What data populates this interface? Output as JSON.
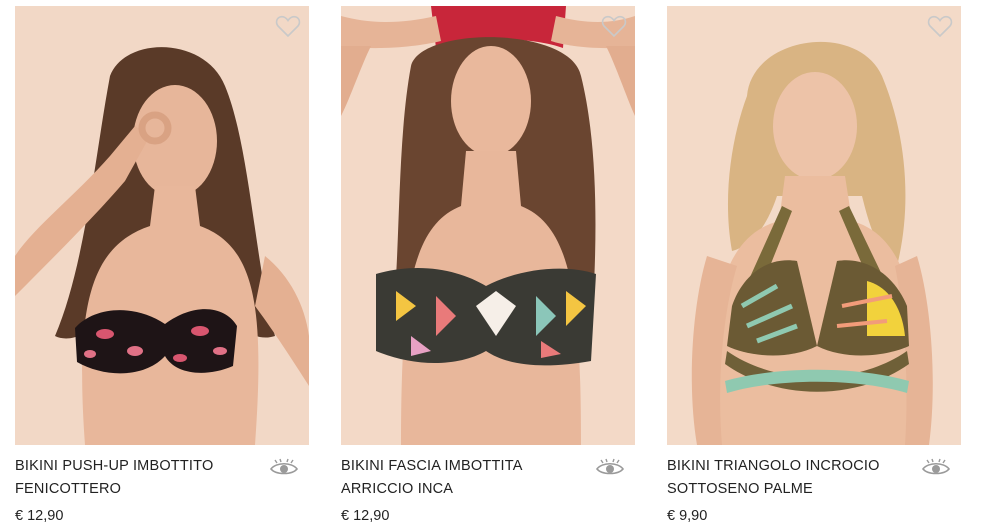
{
  "products": [
    {
      "name_line1": "BIKINI PUSH-UP IMBOTTITO",
      "name_line2": "FENICOTTERO",
      "price": "€ 12,90",
      "wishlist_icon": "heart-outline-icon",
      "quickview_icon": "eye-icon"
    },
    {
      "name_line1": "BIKINI FASCIA IMBOTTITA",
      "name_line2": "ARRICCIO INCA",
      "price": "€ 12,90",
      "wishlist_icon": "heart-outline-icon",
      "quickview_icon": "eye-icon"
    },
    {
      "name_line1": "BIKINI TRIANGOLO INCROCIO",
      "name_line2": "SOTTOSENO PALME",
      "price": "€ 9,90",
      "wishlist_icon": "heart-outline-icon",
      "quickview_icon": "eye-icon"
    }
  ],
  "colors": {
    "photo_background": "#f1d6c4",
    "text": "#222222",
    "icon": "#9a9a9a"
  }
}
